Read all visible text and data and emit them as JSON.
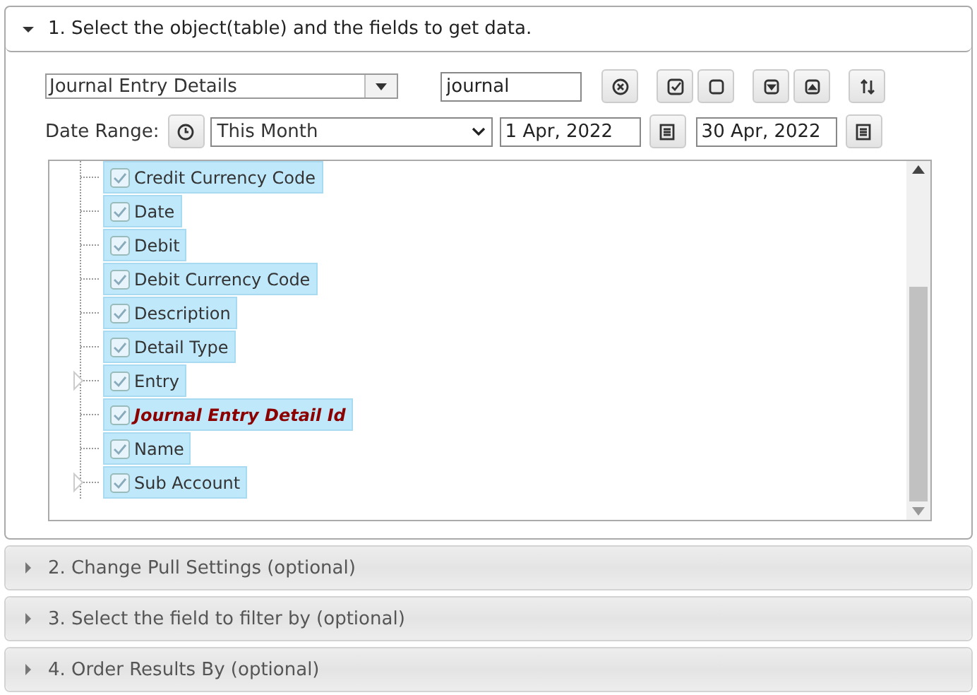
{
  "sections": [
    {
      "title": "1. Select the object(table) and the fields to get data.",
      "expanded": true
    },
    {
      "title": "2. Change Pull Settings (optional)",
      "expanded": false
    },
    {
      "title": "3. Select the field to filter by (optional)",
      "expanded": false
    },
    {
      "title": "4. Order Results By (optional)",
      "expanded": false
    }
  ],
  "object_select": {
    "value": "Journal Entry Details"
  },
  "search": {
    "value": "journal"
  },
  "date_range": {
    "label": "Date Range:",
    "period": "This Month",
    "from": "1 Apr, 2022",
    "to": "30 Apr, 2022"
  },
  "fields": [
    {
      "label": "Credit Currency Code",
      "checked": true,
      "expandable": false,
      "key": false
    },
    {
      "label": "Date",
      "checked": true,
      "expandable": false,
      "key": false
    },
    {
      "label": "Debit",
      "checked": true,
      "expandable": false,
      "key": false
    },
    {
      "label": "Debit Currency Code",
      "checked": true,
      "expandable": false,
      "key": false
    },
    {
      "label": "Description",
      "checked": true,
      "expandable": false,
      "key": false
    },
    {
      "label": "Detail Type",
      "checked": true,
      "expandable": false,
      "key": false
    },
    {
      "label": "Entry",
      "checked": true,
      "expandable": true,
      "key": false
    },
    {
      "label": "Journal Entry Detail Id",
      "checked": true,
      "expandable": false,
      "key": true
    },
    {
      "label": "Name",
      "checked": true,
      "expandable": false,
      "key": false
    },
    {
      "label": "Sub Account",
      "checked": true,
      "expandable": true,
      "key": false
    }
  ]
}
